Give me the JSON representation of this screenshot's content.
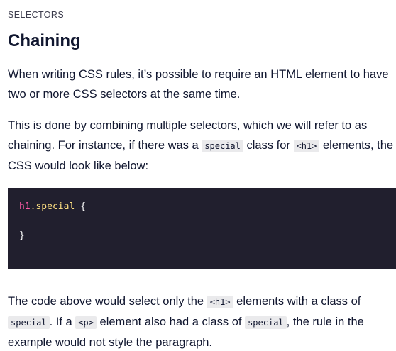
{
  "section": {
    "label": "SELECTORS"
  },
  "title": "Chaining",
  "paragraphs": {
    "p1": "When writing CSS rules, it’s possible to require an HTML element to have two or more CSS selectors at the same time.",
    "p2": {
      "t1": "This is done by combining multiple selectors, which we will refer to as chaining. For instance, if there was a ",
      "code1": "special",
      "t2": " class for ",
      "code2": "<h1>",
      "t3": " elements, the CSS would look like below:"
    },
    "p3": {
      "t1": "The code above would select only the ",
      "code1": "<h1>",
      "t2": " elements with a class of ",
      "code2": "special",
      "t3": ". If a ",
      "code3": "<p>",
      "t4": " element also had a class of ",
      "code4": "special",
      "t5": ", the rule in the example would not style the paragraph."
    }
  },
  "code_block": {
    "line1": {
      "selector": "h1",
      "class": ".special",
      "brace_open": " {"
    },
    "line2": {
      "brace_close": "}"
    }
  },
  "colors": {
    "text": "#10162f",
    "code_bg": "#211f2e",
    "inline_code_bg": "#eaeaec",
    "selector": "#ff5ba8",
    "class": "#ffe082"
  }
}
